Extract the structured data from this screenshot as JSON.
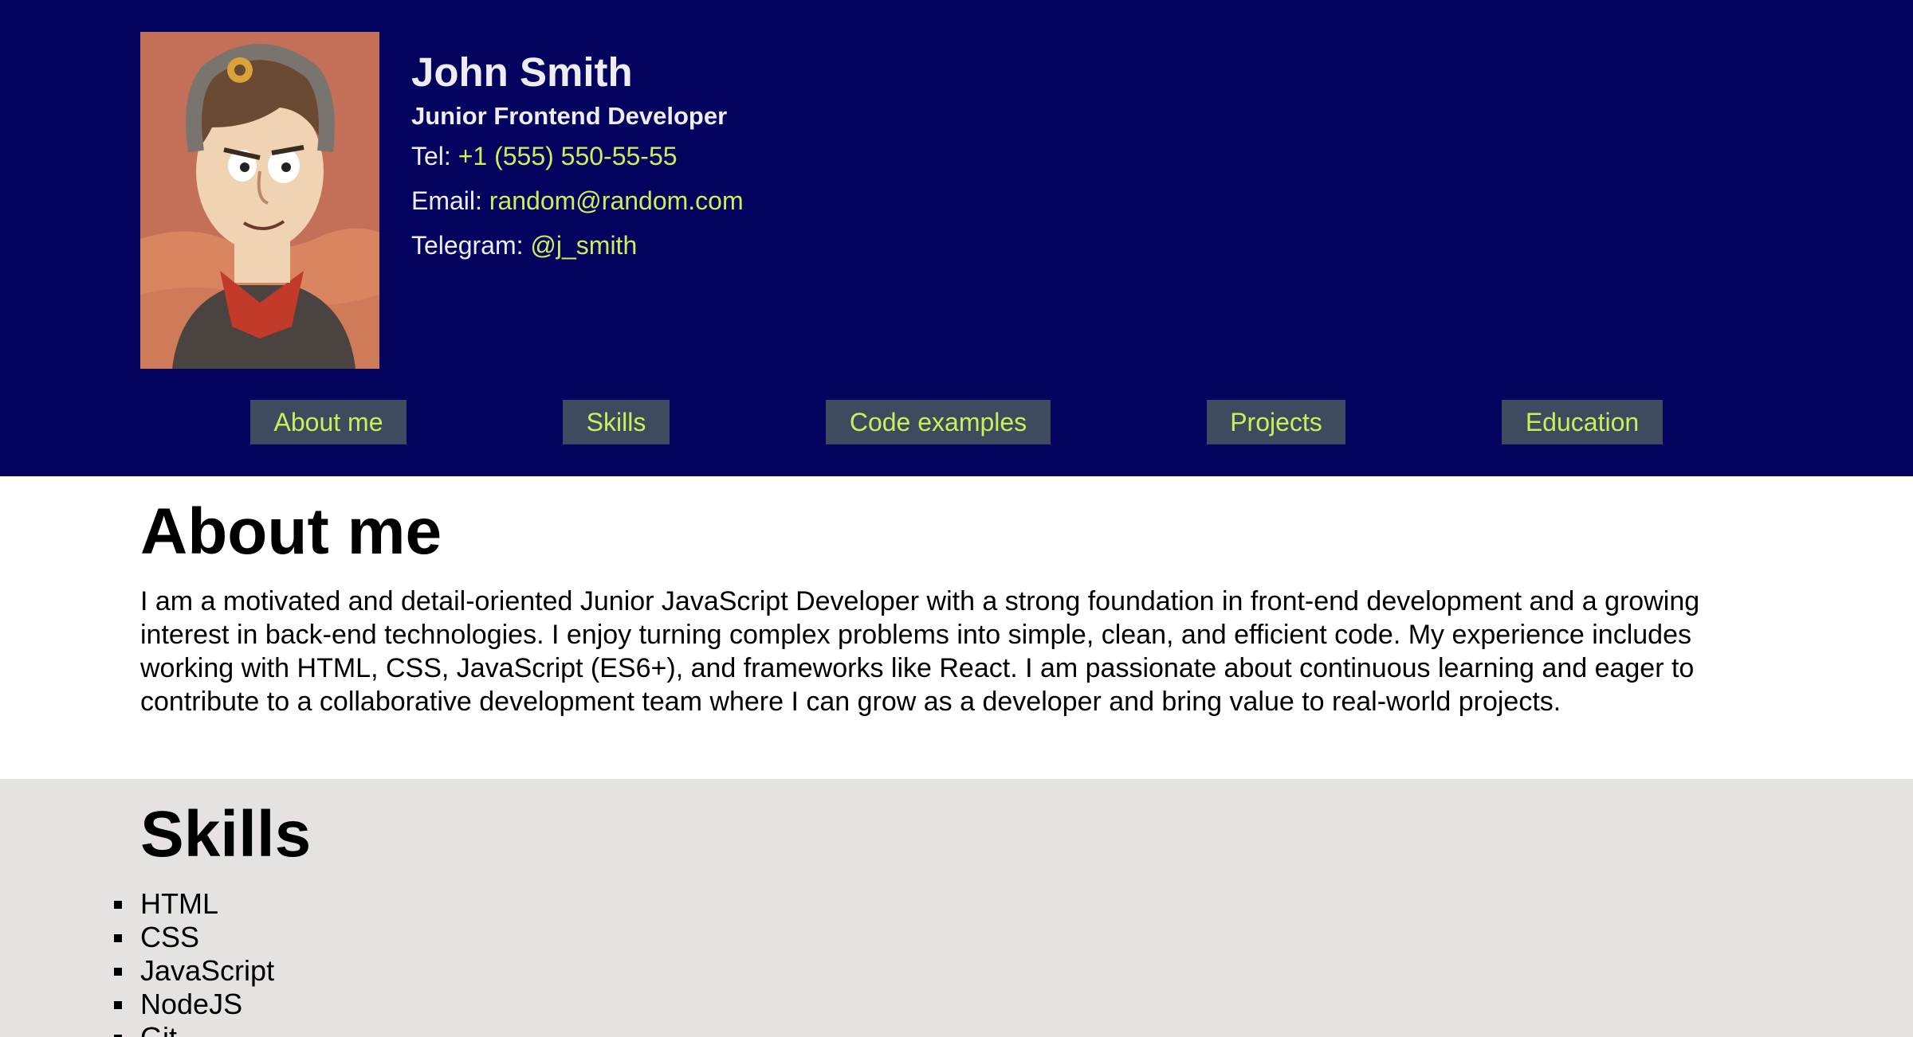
{
  "profile": {
    "name": "John Smith",
    "position": "Junior Frontend Developer",
    "tel_label": "Tel:",
    "tel": "+1 (555) 550-55-55",
    "email_label": "Email:",
    "email": "random@random.com",
    "telegram_label": "Telegram:",
    "telegram": "@j_smith",
    "avatar_icon": "cartoon-avatar-icon"
  },
  "nav": {
    "items": [
      {
        "label": "About me"
      },
      {
        "label": "Skills"
      },
      {
        "label": "Code examples"
      },
      {
        "label": "Projects"
      },
      {
        "label": "Education"
      }
    ]
  },
  "about": {
    "heading": "About me",
    "text": "I am a motivated and detail-oriented Junior JavaScript Developer with a strong foundation in front-end development and a growing interest in back-end technologies. I enjoy turning complex problems into simple, clean, and efficient code. My experience includes working with HTML, CSS, JavaScript (ES6+), and frameworks like React. I am passionate about continuous learning and eager to contribute to a collaborative development team where I can grow as a developer and bring value to real-world projects."
  },
  "skills": {
    "heading": "Skills",
    "items": [
      "HTML",
      "CSS",
      "JavaScript",
      "NodeJS",
      "Git"
    ]
  },
  "colors": {
    "header_bg": "#03035f",
    "accent": "#c8f05a",
    "nav_bg": "#3e4a5e",
    "skills_bg": "#e7e2e2"
  }
}
